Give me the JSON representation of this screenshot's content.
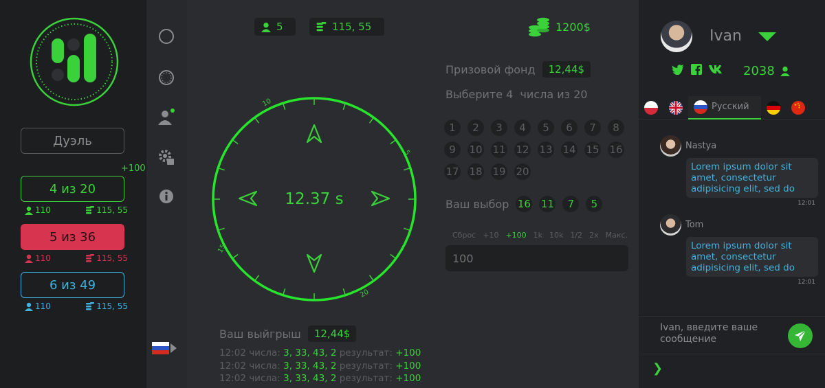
{
  "colors": {
    "accent": "#3ad13a",
    "danger": "#d6344f",
    "info": "#3fb2e0",
    "bg": "#2b2c2f"
  },
  "left": {
    "duel_label": "Дуэль",
    "bonus": "+100",
    "modes": [
      {
        "label": "4 из 20",
        "players": "110",
        "pot": "115, 55"
      },
      {
        "label": "5 из 36",
        "players": "110",
        "pot": "115, 55"
      },
      {
        "label": "6 из 49",
        "players": "110",
        "pot": "115, 55"
      }
    ]
  },
  "rail": {
    "icons": [
      "circle-outline-icon",
      "globe-outline-icon",
      "user-online-icon",
      "settings-icon",
      "info-icon"
    ],
    "language_flag": "russia-flag-icon"
  },
  "game": {
    "players": "5",
    "pot": "115, 55",
    "bank": "1200$",
    "timer": "12.37 s",
    "dial_labels": [
      "10",
      "5",
      "15",
      "20"
    ],
    "prize_label": "Призовой фонд",
    "prize_value": "12,44$",
    "choose_label": "Выберите 4  числа из 20",
    "numbers": [
      "1",
      "2",
      "3",
      "4",
      "5",
      "6",
      "7",
      "8",
      "9",
      "10",
      "11",
      "12",
      "13",
      "14",
      "15",
      "16",
      "17",
      "18",
      "19",
      "20"
    ],
    "your_choice_label": "Ваш выбор",
    "your_choice": [
      "16",
      "11",
      "7",
      "5"
    ],
    "quick_bets": [
      "Сброс",
      "+10",
      "+100",
      "1k",
      "10k",
      "1/2",
      "2x",
      "Макс."
    ],
    "active_quick_bet": "+100",
    "bet_value": "100",
    "win_label": "Ваш выйгрыш",
    "win_value": "12,44$",
    "history": [
      {
        "time": "12:02",
        "numbers_label": "числа:",
        "numbers": "3, 33, 43, 2",
        "result_label": "результат:",
        "result": "+100"
      },
      {
        "time": "12:02",
        "numbers_label": "числа:",
        "numbers": "3, 33, 43, 2",
        "result_label": "результат:",
        "result": "+100"
      },
      {
        "time": "12:02",
        "numbers_label": "числа:",
        "numbers": "3, 33, 43, 2",
        "result_label": "результат:",
        "result": "+100"
      }
    ]
  },
  "profile": {
    "username": "Ivan",
    "points": "2038",
    "socials": [
      "twitter-icon",
      "facebook-icon",
      "vk-icon"
    ]
  },
  "chat": {
    "languages": [
      "pl",
      "gb",
      "ru",
      "de",
      "cn"
    ],
    "active_language": "Русский",
    "messages": [
      {
        "author": "Nastya",
        "text": "Lorem ipsum dolor sit amet, consectetur adipisicing elit, sed do",
        "time": "12:01"
      },
      {
        "author": "Tom",
        "text": "Lorem ipsum dolor sit amet, consectetur adipisicing elit, sed do",
        "time": "12:01"
      }
    ],
    "input_placeholder": "Ivan, введите ваше сообщение"
  }
}
